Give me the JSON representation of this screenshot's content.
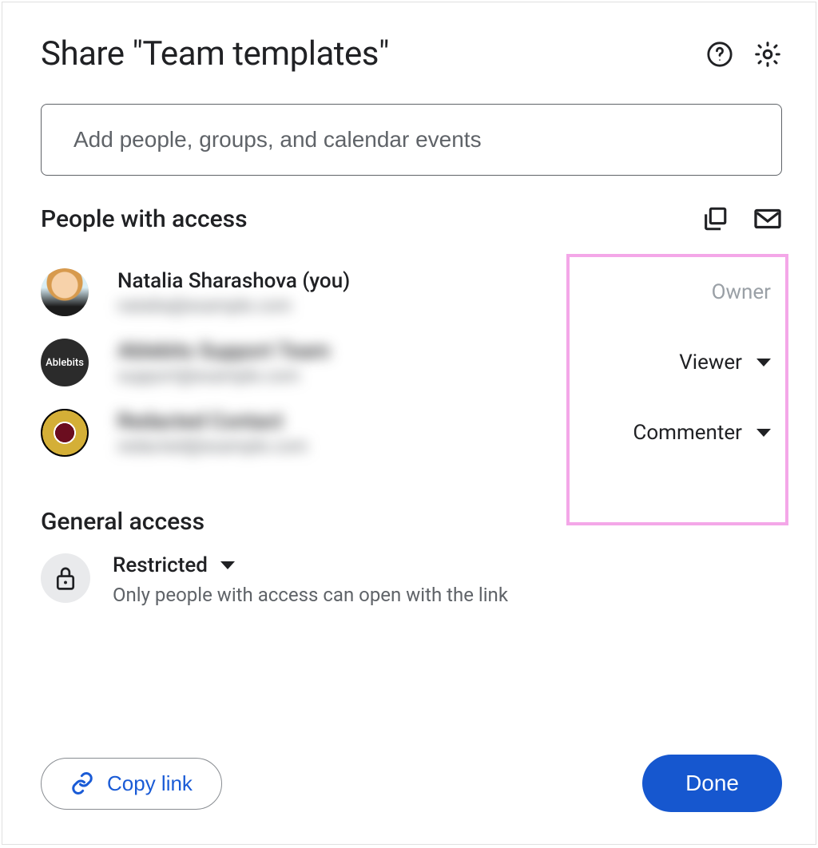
{
  "header": {
    "title": "Share \"Team templates\""
  },
  "input": {
    "placeholder": "Add people, groups, and calendar events"
  },
  "people_section": {
    "title": "People with access"
  },
  "people": [
    {
      "name": "Natalia Sharashova (you)",
      "email": "natalia@example.com",
      "role": "Owner",
      "avatar_label": ""
    },
    {
      "name": "Ablebits Support Team",
      "email": "support@example.com",
      "role": "Viewer",
      "avatar_label": "Ablebits"
    },
    {
      "name": "Redacted Contact",
      "email": "redacted@example.com",
      "role": "Commenter",
      "avatar_label": ""
    }
  ],
  "general": {
    "title": "General access",
    "mode": "Restricted",
    "description": "Only people with access can open with the link"
  },
  "footer": {
    "copy_link": "Copy link",
    "done": "Done"
  }
}
